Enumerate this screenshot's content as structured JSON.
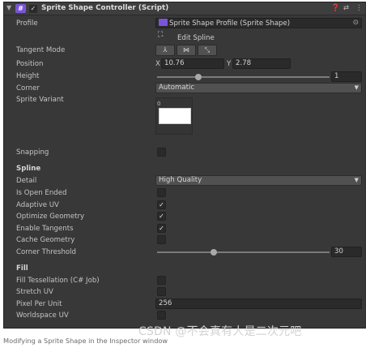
{
  "header": {
    "title": "Sprite Shape Controller (Script)",
    "fold_icon": "▼",
    "script_icon": "#",
    "enabled_check": "✓",
    "help_icon": "❓",
    "preset_icon": "⇄",
    "menu_icon": "⋮"
  },
  "profile": {
    "label": "Profile",
    "value": "Sprite Shape Profile (Sprite Shape)",
    "picker_icon": "⊙"
  },
  "edit_spline": {
    "icon": "⛶",
    "label": "Edit Spline"
  },
  "tangent_mode": {
    "label": "Tangent Mode",
    "buttons": [
      "⅄",
      "⋈",
      "⤡"
    ]
  },
  "position": {
    "label": "Position",
    "x_label": "X",
    "x_value": "10.76",
    "y_label": "Y",
    "y_value": "2.78"
  },
  "height": {
    "label": "Height",
    "value": "1",
    "slider_fraction": 0.24
  },
  "corner": {
    "label": "Corner",
    "value": "Automatic"
  },
  "sprite_variant": {
    "label": "Sprite Variant",
    "index": "0"
  },
  "snapping": {
    "label": "Snapping",
    "checked": false
  },
  "spline": {
    "title": "Spline",
    "detail_label": "Detail",
    "detail_value": "High Quality",
    "is_open_ended": {
      "label": "Is Open Ended",
      "checked": false
    },
    "adaptive_uv": {
      "label": "Adaptive UV",
      "checked": true
    },
    "optimize_geometry": {
      "label": "Optimize Geometry",
      "checked": true
    },
    "enable_tangents": {
      "label": "Enable Tangents",
      "checked": true
    },
    "cache_geometry": {
      "label": "Cache Geometry",
      "checked": false
    },
    "corner_threshold": {
      "label": "Corner Threshold",
      "value": "30",
      "slider_fraction": 0.33
    }
  },
  "fill": {
    "title": "Fill",
    "fill_tessellation": {
      "label": "Fill Tessellation (C# Job)",
      "checked": false
    },
    "stretch_uv": {
      "label": "Stretch UV",
      "checked": false
    },
    "pixel_per_unit": {
      "label": "Pixel Per Unit",
      "value": "256"
    },
    "worldspace_uv": {
      "label": "Worldspace UV",
      "checked": false
    }
  },
  "check_glyph": "✓",
  "dropdown_caret": "▼",
  "caption": "Modifying a Sprite Shape in the Inspector window",
  "watermark": "CSDN @不会真有人是二次元吧"
}
